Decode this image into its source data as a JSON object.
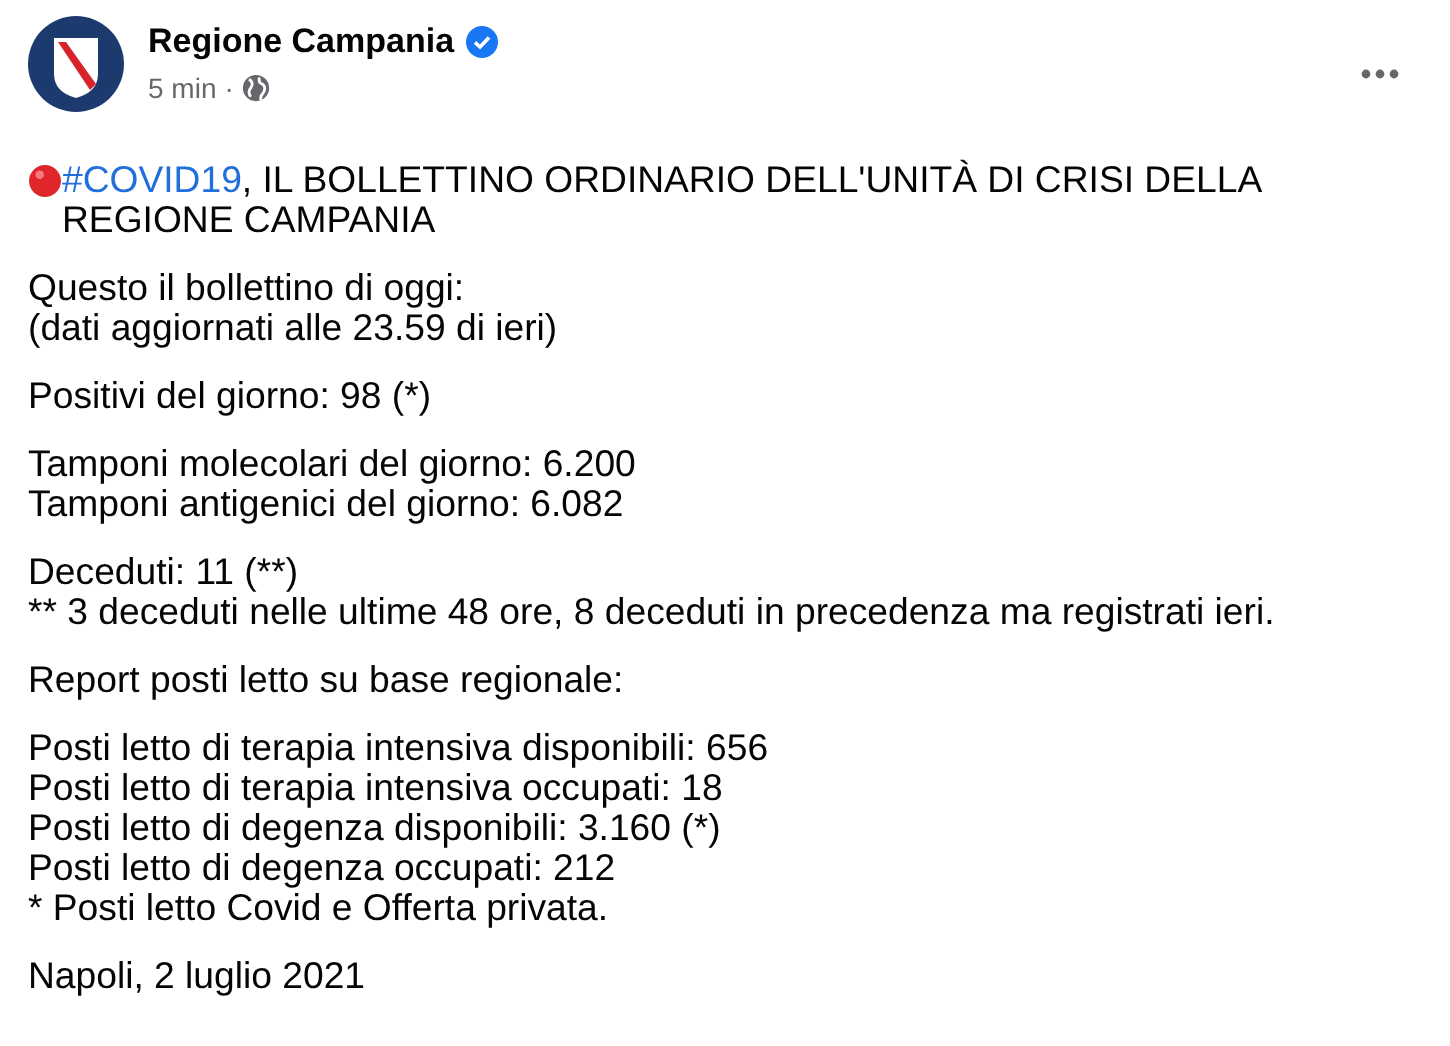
{
  "post": {
    "author": "Regione Campania",
    "verified": true,
    "time": "5 min",
    "separator": "·",
    "public": true
  },
  "headline": {
    "hashtag": "#COVID19",
    "text": ", IL BOLLETTINO ORDINARIO DELL'UNITÀ DI CRISI DELLA REGIONE CAMPANIA"
  },
  "paragraphs": [
    [
      "Questo il bollettino di oggi:",
      "(dati aggiornati alle 23.59 di ieri)"
    ],
    [
      "Positivi del giorno: 98 (*)"
    ],
    [
      "Tamponi molecolari del giorno: 6.200",
      "Tamponi antigenici del giorno: 6.082"
    ],
    [
      "Deceduti: 11 (**)",
      "** 3 deceduti nelle ultime 48 ore, 8 deceduti in precedenza ma registrati ieri."
    ],
    [
      "Report posti letto su base regionale:"
    ],
    [
      "Posti letto di terapia intensiva disponibili: 656",
      "Posti letto di terapia intensiva occupati: 18",
      "Posti letto di degenza disponibili: 3.160 (*)",
      "Posti letto di degenza occupati: 212",
      "* Posti letto Covid e Offerta privata."
    ],
    [
      "Napoli, 2 luglio 2021"
    ]
  ]
}
